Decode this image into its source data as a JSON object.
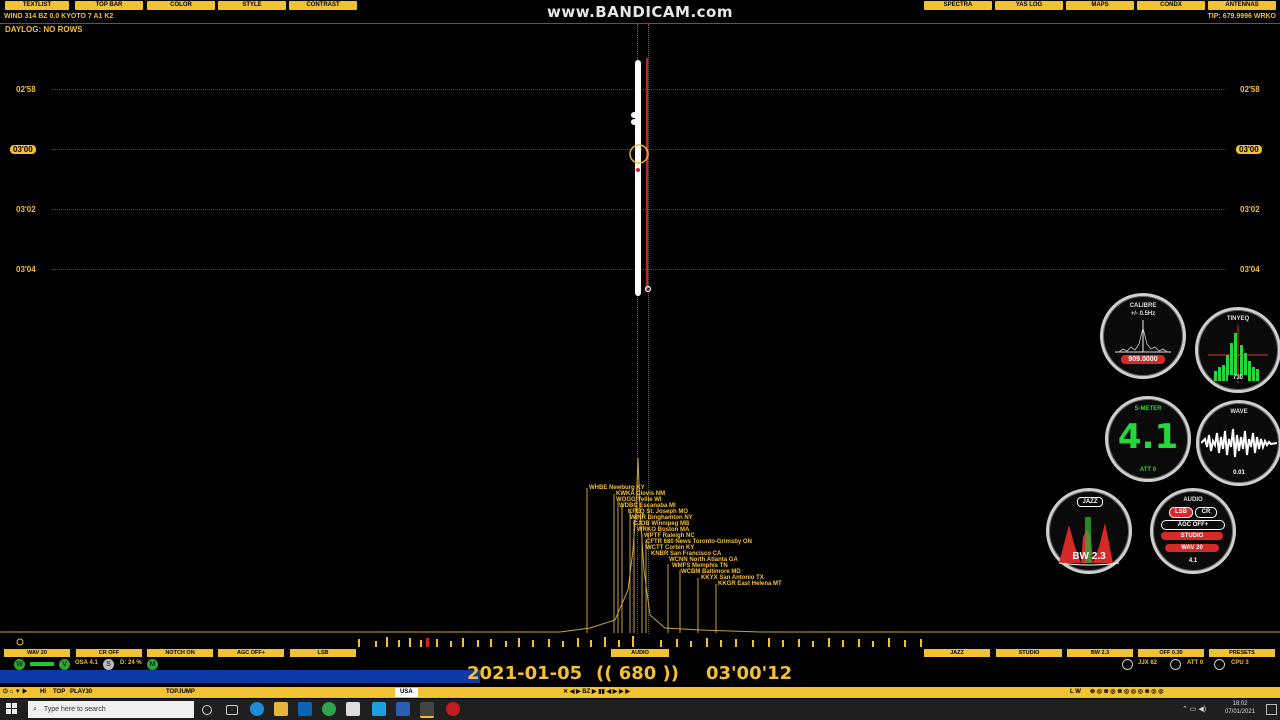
{
  "top_buttons_left": [
    "TEXTLIST",
    "TOP BAR",
    "COLOR",
    "STYLE",
    "CONTRAST"
  ],
  "top_buttons_right": [
    "SPECTRA",
    "YAS LOG",
    "MAPS",
    "CONDX",
    "ANTENNAS"
  ],
  "status_left": "WIND 314  BZ 0.0  KYOTO 7  A1 K2",
  "status_right": "TIP: 679.9996 WRKO",
  "watermark": "www.BANDICAM.com",
  "daylog": "DAYLOG: NO ROWS",
  "time_labels": [
    "02'58",
    "03'00",
    "03'02",
    "03'04"
  ],
  "stations": [
    "WHBE Newburg KY",
    "KWKA Clovis NM",
    "WOGG Yellie WI",
    "WDBC Escanaba MI",
    "KFEQ St. Joseph MO",
    "WINR Binghamton NY",
    "CJOB Winnipeg MB",
    "WRKO Boston MA",
    "WPTF Raleigh NC",
    "CFTR 680 News Toronto-Grimsby ON",
    "WCTT Corbin KY",
    "KNBR San Francisco CA",
    "WCNN North Atlanta GA",
    "WMFS Memphis TN",
    "WCBM Baltimore MD",
    "KKYX San Antonio TX",
    "KKGR East Helena MT"
  ],
  "bottom_buttons_left": [
    "WAV 20",
    "CR OFF",
    "NOTCH ON",
    "AGC OFF+",
    "LSB"
  ],
  "audio_label": "AUDIO",
  "bottom_buttons_right": [
    "JAZZ",
    "STUDIO",
    "BW 2.3",
    "OFF 0.30",
    "PRESETS"
  ],
  "date": "2021-01-05",
  "frequency": "(( 680 ))",
  "time": "03'00'12",
  "mini_status": {
    "osa": "OSA 4.1",
    "d": "D: 24 %"
  },
  "right_mini": {
    "jx": "JJX 62",
    "att": "ATT 0",
    "cpu": "CPU 3"
  },
  "bottom_strip": {
    "top": "TOP",
    "play": "PLAY30",
    "topjump": "TOPJUMP",
    "usa": "USA",
    "lw": "L W"
  },
  "gauges": {
    "calibre": {
      "title": "CALIBRE",
      "sub": "+/- 0.5Hz",
      "value": "909.0000"
    },
    "tinyeq": {
      "title": "TINYEQ",
      "value": "730"
    },
    "smeter": {
      "title": "S-METER",
      "value": "4.1",
      "att": "ATT 0"
    },
    "wave": {
      "title": "WAVE",
      "value": "0.01"
    },
    "jazz": {
      "title": "JAZZ",
      "bw": "BW 2.3"
    },
    "audio": {
      "title": "AUDIO",
      "lsb": "LSB",
      "cr": "CR",
      "agc": "AGC OFF+",
      "studio": "STUDIO",
      "wav": "WAV 20",
      "value": "4.1"
    }
  },
  "taskbar": {
    "search": "Type here to search",
    "clock_time": "18:02",
    "clock_date": "07/01/2021"
  }
}
